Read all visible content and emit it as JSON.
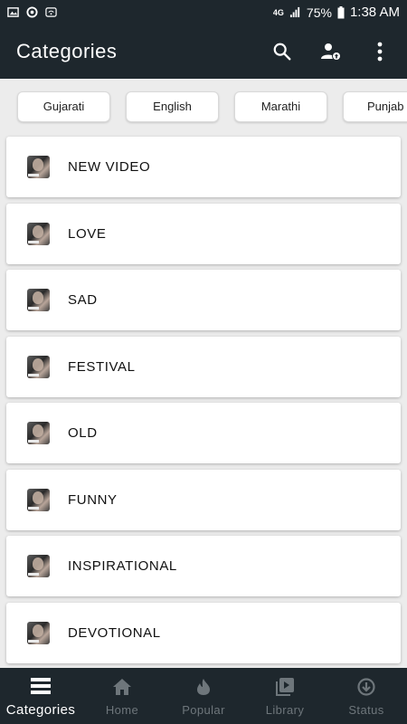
{
  "status_bar": {
    "network": "4G",
    "battery": "75%",
    "time": "1:38 AM"
  },
  "app_bar": {
    "title": "Categories",
    "icons": [
      "search-icon",
      "account-upload-icon",
      "more-vert-icon"
    ]
  },
  "language_chips": [
    {
      "label": "Gujarati"
    },
    {
      "label": "English"
    },
    {
      "label": "Marathi"
    },
    {
      "label": "Punjab"
    }
  ],
  "categories": [
    {
      "label": "NEW VIDEO"
    },
    {
      "label": "LOVE"
    },
    {
      "label": "SAD"
    },
    {
      "label": "FESTIVAL"
    },
    {
      "label": "OLD"
    },
    {
      "label": "FUNNY"
    },
    {
      "label": "INSPIRATIONAL"
    },
    {
      "label": "DEVOTIONAL"
    }
  ],
  "bottom_nav": [
    {
      "label": "Categories",
      "icon": "list-icon",
      "active": true
    },
    {
      "label": "Home",
      "icon": "home-icon",
      "active": false
    },
    {
      "label": "Popular",
      "icon": "flame-icon",
      "active": false
    },
    {
      "label": "Library",
      "icon": "video-library-icon",
      "active": false
    },
    {
      "label": "Status",
      "icon": "download-circle-icon",
      "active": false
    }
  ],
  "colors": {
    "bar_background": "#1e272d",
    "page_background": "#ececec",
    "inactive_nav": "#6e767b"
  }
}
